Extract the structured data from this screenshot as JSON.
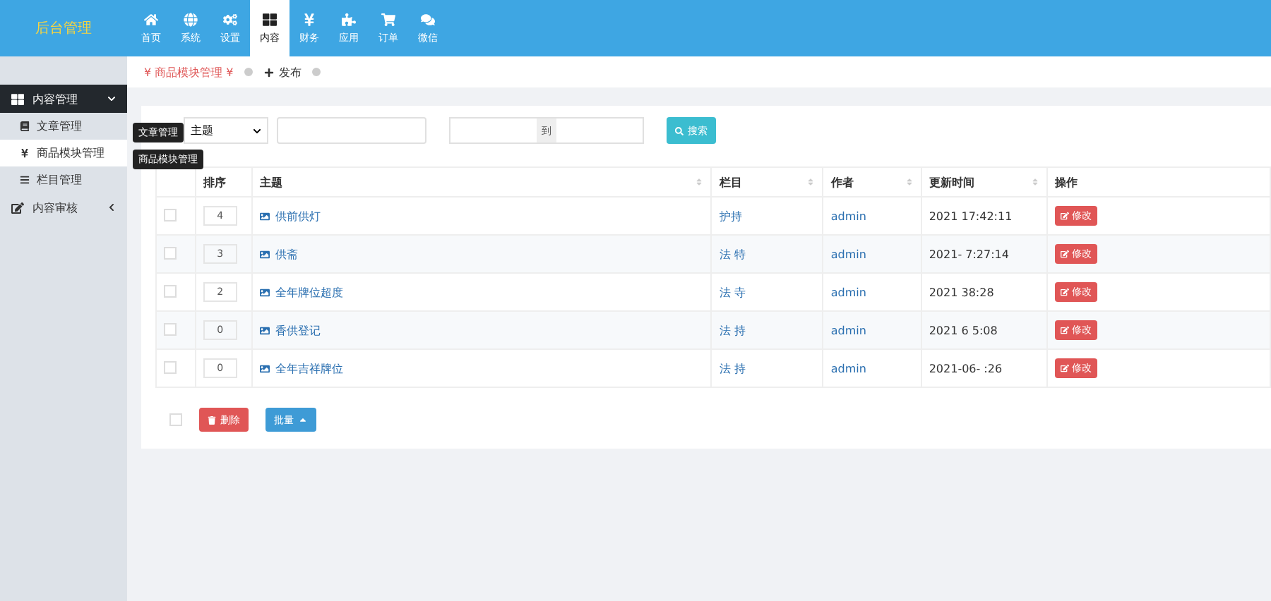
{
  "logo": "后台管理",
  "nav": [
    {
      "label": "首页",
      "selected": false
    },
    {
      "label": "系统",
      "selected": false
    },
    {
      "label": "设置",
      "selected": false
    },
    {
      "label": "内容",
      "selected": true
    },
    {
      "label": "财务",
      "selected": false
    },
    {
      "label": "应用",
      "selected": false
    },
    {
      "label": "订单",
      "selected": false
    },
    {
      "label": "微信",
      "selected": false
    }
  ],
  "sidebar": [
    {
      "label": "内容管理",
      "expanded": true,
      "children": [
        {
          "label": "文章管理",
          "selected": false
        },
        {
          "label": "商品模块管理",
          "selected": true
        },
        {
          "label": "栏目管理",
          "selected": false
        }
      ]
    },
    {
      "label": "内容审核",
      "expanded": false
    }
  ],
  "tooltips": [
    "文章管理",
    "商品模块管理"
  ],
  "breadcrumb": {
    "current": "¥ 商品模块管理 ¥",
    "action": "发布"
  },
  "filter": {
    "select": "主题",
    "range_separator": "到",
    "search_button": "搜索"
  },
  "table": {
    "columns": [
      "排序",
      "主题",
      "栏目",
      "作者",
      "更新时间",
      "操作"
    ],
    "rows": [
      {
        "checked": false,
        "order": "4",
        "title": "供前供灯",
        "column": "护持",
        "author": "admin",
        "updated": "2021 17:42:11",
        "action": "修改"
      },
      {
        "checked": false,
        "order": "3",
        "title": "供斋",
        "column": "法 特",
        "author": "admin",
        "updated": "2021- 7:27:14",
        "action": "修改"
      },
      {
        "checked": false,
        "order": "2",
        "title": "全年牌位超度",
        "column": "法 寺",
        "author": "admin",
        "updated": "2021 38:28",
        "action": "修改"
      },
      {
        "checked": false,
        "order": "0",
        "title": "香供登记",
        "column": "法 持",
        "author": "admin",
        "updated": "2021 6 5:08",
        "action": "修改"
      },
      {
        "checked": false,
        "order": "0",
        "title": "全年吉祥牌位",
        "column": "法 持",
        "author": "admin",
        "updated": "2021-06- :26",
        "action": "修改"
      }
    ]
  },
  "footer": {
    "checked": false,
    "delete_button": "删除",
    "batch_button": "批量"
  }
}
